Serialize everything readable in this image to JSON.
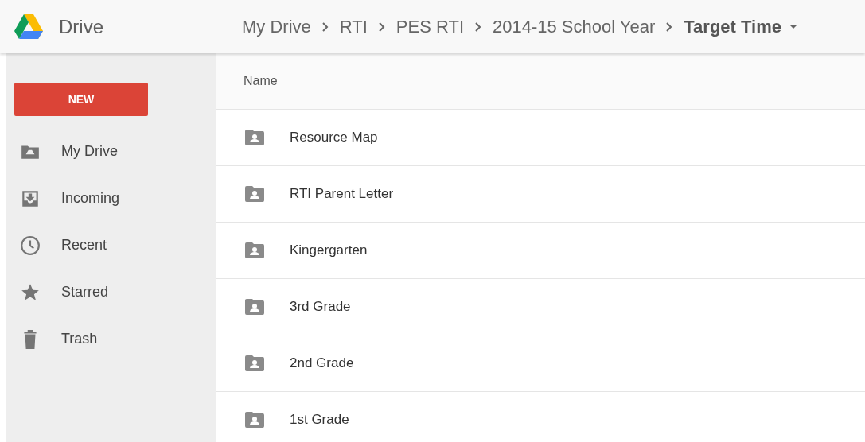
{
  "app": {
    "title": "Drive"
  },
  "breadcrumbs": [
    {
      "label": "My Drive",
      "current": false
    },
    {
      "label": "RTI",
      "current": false
    },
    {
      "label": "PES RTI",
      "current": false
    },
    {
      "label": "2014-15 School Year",
      "current": false
    },
    {
      "label": "Target Time",
      "current": true
    }
  ],
  "new_button": "NEW",
  "sidebar": {
    "items": [
      {
        "kind": "drive",
        "label": "My Drive"
      },
      {
        "kind": "incoming",
        "label": "Incoming"
      },
      {
        "kind": "recent",
        "label": "Recent"
      },
      {
        "kind": "starred",
        "label": "Starred"
      },
      {
        "kind": "trash",
        "label": "Trash"
      }
    ]
  },
  "list": {
    "column": "Name",
    "rows": [
      {
        "name": "Resource Map"
      },
      {
        "name": "RTI Parent Letter"
      },
      {
        "name": "Kingergarten"
      },
      {
        "name": "3rd Grade"
      },
      {
        "name": "2nd Grade"
      },
      {
        "name": "1st Grade"
      }
    ]
  }
}
